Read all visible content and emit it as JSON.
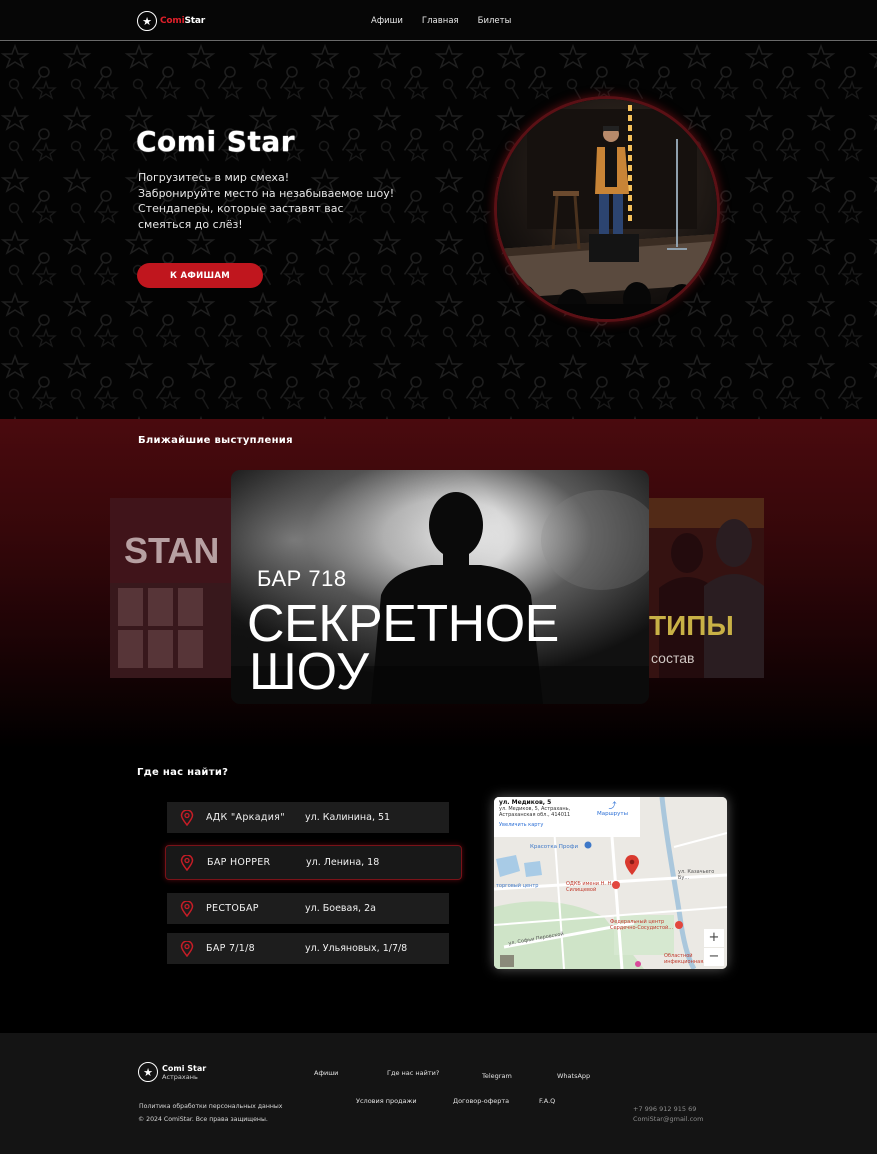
{
  "header": {
    "logo_red": "Comi",
    "logo_white": "Star",
    "nav": [
      "Афиши",
      "Главная",
      "Билеты"
    ]
  },
  "hero": {
    "title": "Comi Star",
    "text_lines": [
      "Погрузитесь в мир смеха!",
      "Забронируйте место на незабываемое шоу!",
      "Стендаперы, которые заставят вас",
      "смеяться до слёз!"
    ],
    "button": "К АФИШАМ"
  },
  "shows": {
    "title": "Ближайшие выступления",
    "main_card": {
      "venue": "БАР 718",
      "name_line1": "СЕКРЕТНОЕ",
      "name_line2": "ШОУ"
    },
    "left_card": {
      "big_text": "STAN"
    },
    "right_card": {
      "big_text": "ТИПЫ",
      "small_text": "состав"
    }
  },
  "find": {
    "title": "Где нас найти?",
    "venues": [
      {
        "name": "АДК \"Аркадия\"",
        "address": "ул. Калинина, 51"
      },
      {
        "name": "БАР HOPPER",
        "address": "ул. Ленина, 18"
      },
      {
        "name": "РЕСТОБАР",
        "address": "ул. Боевая, 2а"
      },
      {
        "name": "БАР 7/1/8",
        "address": "ул. Ульяновых, 1/7/8"
      }
    ],
    "map": {
      "street": "ул. Медиков, 5",
      "address_line1": "ул. Медиков, 5, Астрахань,",
      "address_line2": "Астраханская обл., 414011",
      "enlarge": "Увеличить карту",
      "route": "Маршруты",
      "zoom_in": "+",
      "zoom_out": "−",
      "labels": {
        "beauty": "Красотка Профи",
        "hospital": "ОДКБ имени Н. Н. Силищевой",
        "center": "Федеральный центр Сердечно-Сосудистой...",
        "street1": "ул. Софьи Перовской",
        "street2": "ул. Казачьего Бу...",
        "street3": "Областной инфекционная...",
        "tc": "торговый центр"
      }
    }
  },
  "footer": {
    "brand": "Comi Star",
    "city": "Астрахань",
    "links_row1": [
      "Афиши",
      "Где нас найти?",
      "Telegram",
      "WhatsApp"
    ],
    "links_row2": [
      "Условия продажи",
      "Договор-оферта",
      "F.A.Q"
    ],
    "privacy": "Политика обработки персональных данных",
    "copyright": "© 2024 ComiStar. Все права защищены.",
    "phone": "+7 996 912 915 69",
    "email": "ComiStar@gmail.com"
  }
}
